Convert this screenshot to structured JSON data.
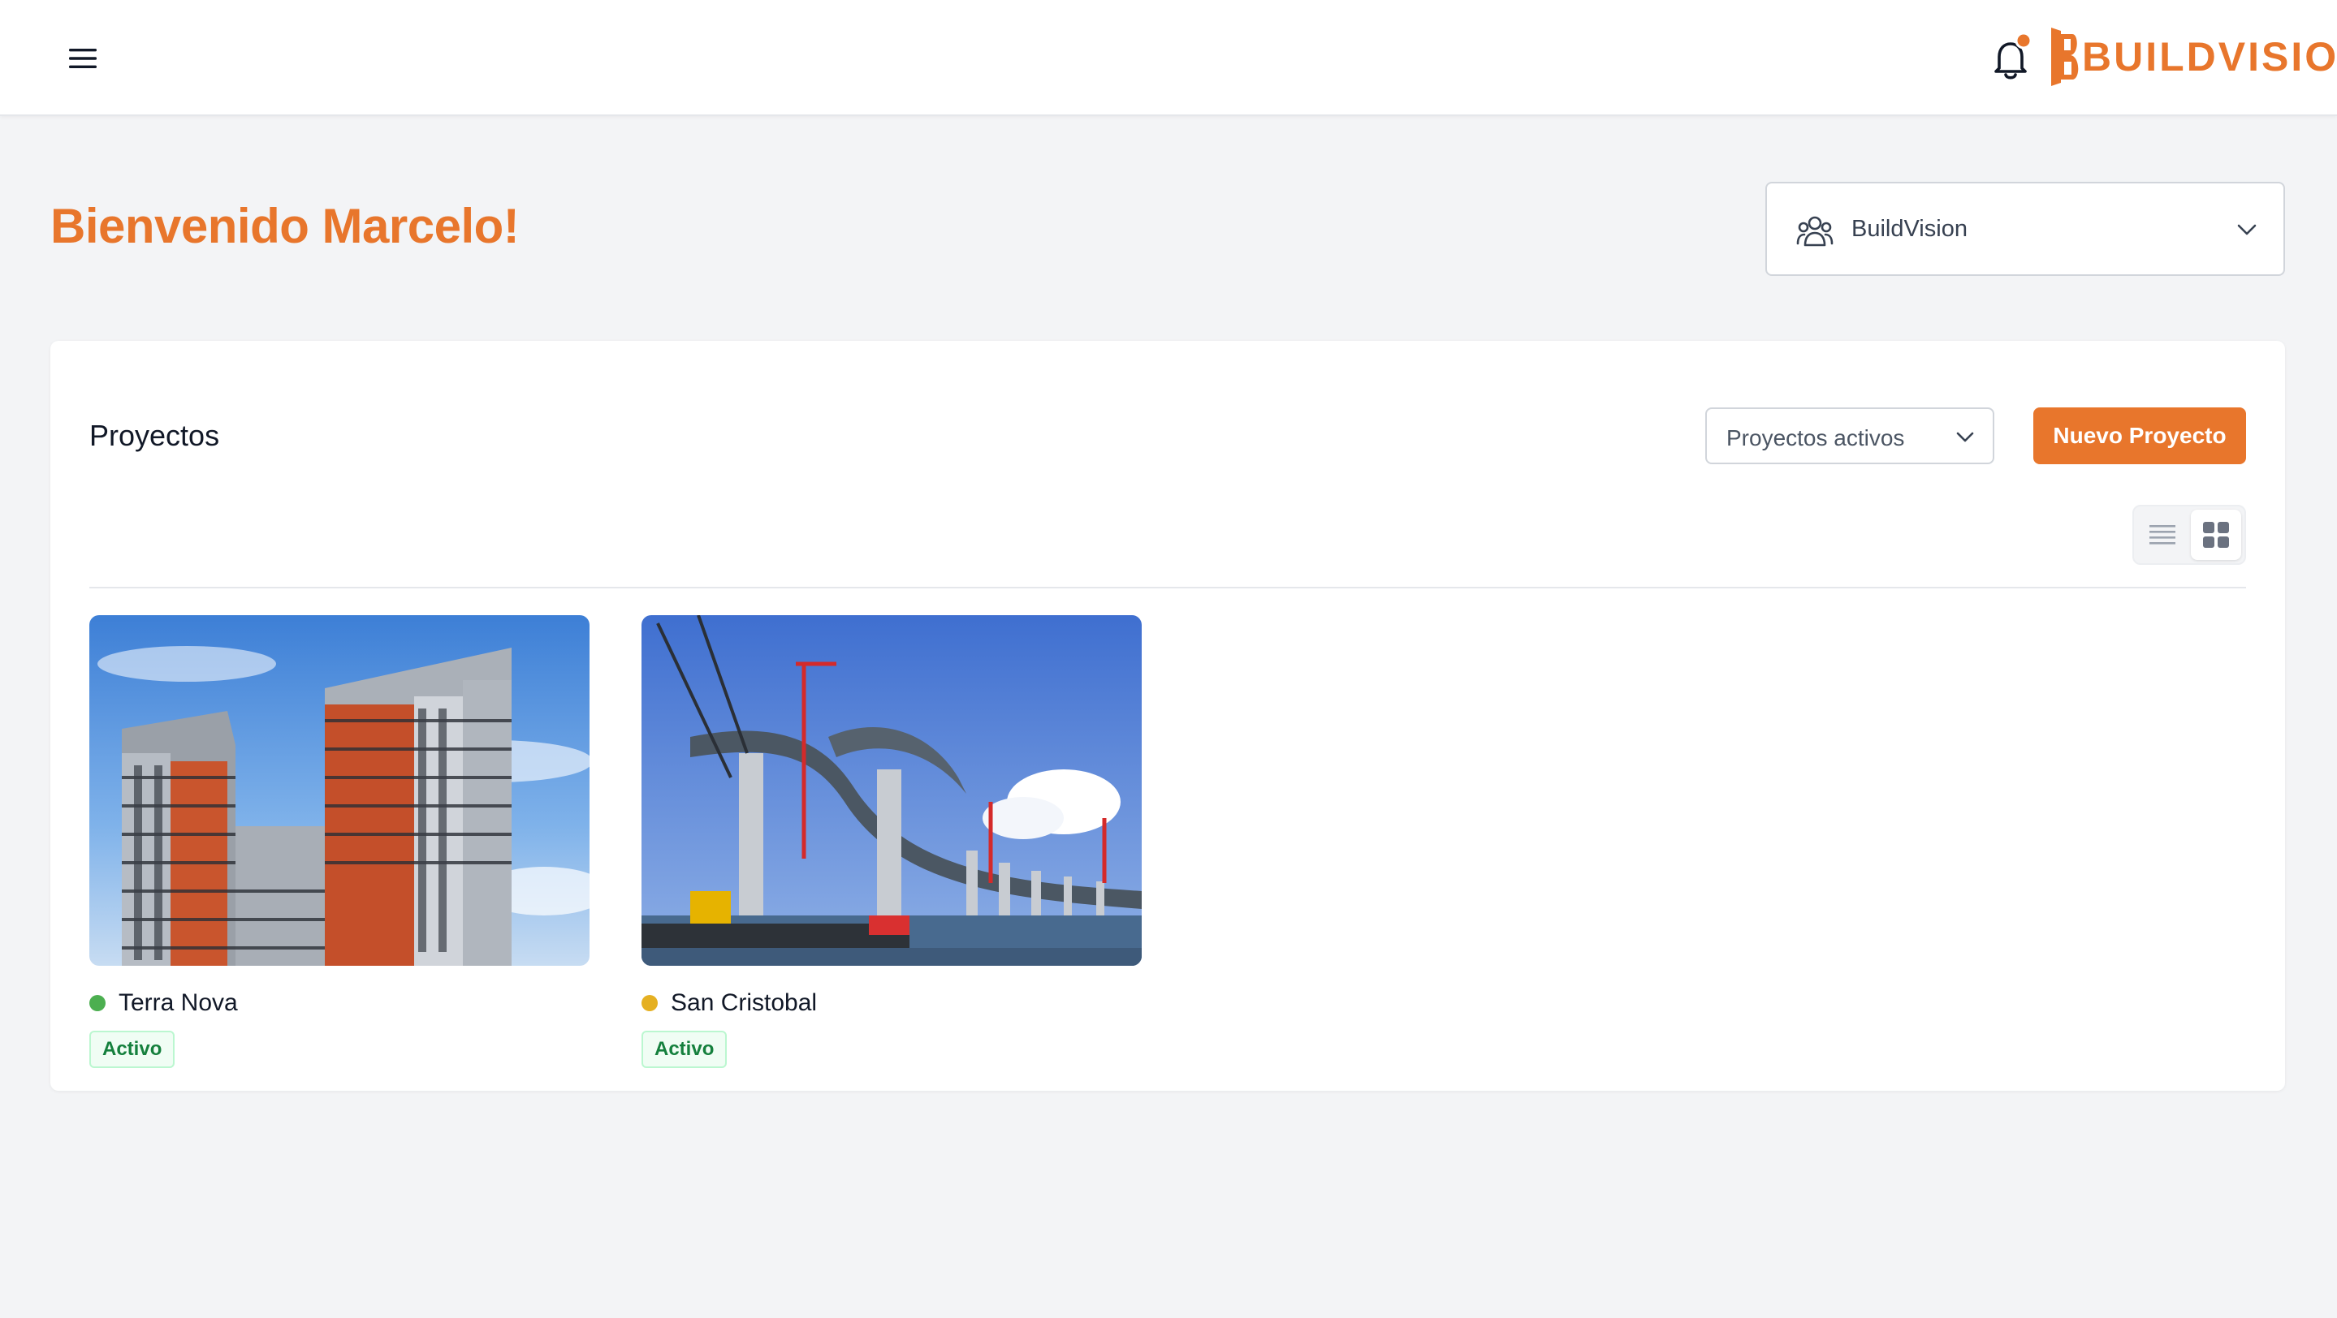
{
  "app": {
    "brand": "BUILDVISION",
    "accent_color": "#e8762c"
  },
  "topbar": {
    "menu_icon": "hamburger-menu-icon",
    "notification_icon": "bell-icon",
    "has_unread_notifications": true
  },
  "welcome": {
    "title": "Bienvenido Marcelo!"
  },
  "organization": {
    "icon": "users-icon",
    "selected": "BuildVision"
  },
  "projects": {
    "title": "Proyectos",
    "filter": {
      "selected": "Proyectos activos"
    },
    "new_button_label": "Nuevo Proyecto",
    "view_modes": [
      {
        "name": "list",
        "icon": "list-view-icon",
        "active": false
      },
      {
        "name": "grid",
        "icon": "grid-view-icon",
        "active": true
      }
    ],
    "items": [
      {
        "name": "Terra Nova",
        "status": "Activo",
        "dot_color": "#4caf50",
        "image": "residential-tower-photo"
      },
      {
        "name": "San Cristobal",
        "status": "Activo",
        "dot_color": "#e5b022",
        "image": "bridge-construction-photo"
      }
    ]
  }
}
